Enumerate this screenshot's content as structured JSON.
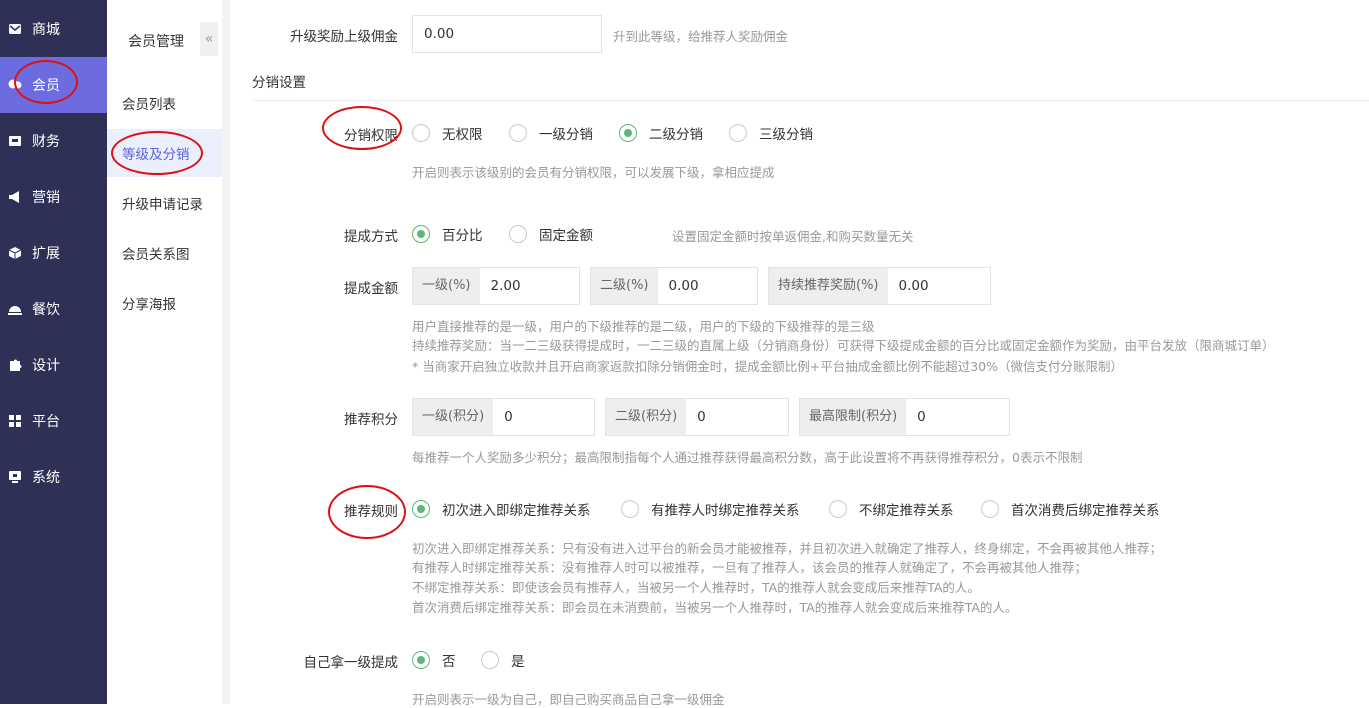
{
  "nav": {
    "items": [
      {
        "label": "商城",
        "icon": "mail-icon"
      },
      {
        "label": "会员",
        "icon": "member-icon"
      },
      {
        "label": "财务",
        "icon": "wallet-icon"
      },
      {
        "label": "营销",
        "icon": "megaphone-icon"
      },
      {
        "label": "扩展",
        "icon": "cube-icon"
      },
      {
        "label": "餐饮",
        "icon": "dish-icon"
      },
      {
        "label": "设计",
        "icon": "puzzle-icon"
      },
      {
        "label": "平台",
        "icon": "grid-icon"
      },
      {
        "label": "系统",
        "icon": "monitor-icon"
      }
    ],
    "active_color": "#6c6ce0",
    "background": "#2f3055"
  },
  "submenu": {
    "title": "会员管理",
    "collapse_glyph": "«",
    "items": [
      {
        "label": "会员列表"
      },
      {
        "label": "等级及分销"
      },
      {
        "label": "升级申请记录"
      },
      {
        "label": "会员关系图"
      },
      {
        "label": "分享海报"
      }
    ]
  },
  "form": {
    "upgrade_reward": {
      "label": "升级奖励上级佣金",
      "value": "0.00",
      "hint": "升到此等级，给推荐人奖励佣金"
    },
    "section_title": "分销设置",
    "permission": {
      "label": "分销权限",
      "options": [
        "无权限",
        "一级分销",
        "二级分销",
        "三级分销"
      ],
      "selected": 2,
      "hint": "开启则表示该级别的会员有分销权限，可以发展下级，拿相应提成"
    },
    "commission_mode": {
      "label": "提成方式",
      "options": [
        "百分比",
        "固定金额"
      ],
      "selected": 0,
      "hint": "设置固定金额时按单返佣金,和购买数量无关"
    },
    "commission_amount": {
      "label": "提成金额",
      "fields": [
        {
          "addon": "一级(%)",
          "value": "2.00"
        },
        {
          "addon": "二级(%)",
          "value": "0.00"
        },
        {
          "addon": "持续推荐奖励(%)",
          "value": "0.00"
        }
      ],
      "hints": [
        "用户直接推荐的是一级，用户的下级推荐的是二级，用户的下级的下级推荐的是三级",
        "持续推荐奖励：当一二三级获得提成时，一二三级的直属上级（分销商身份）可获得下级提成金额的百分比或固定金额作为奖励，由平台发放（限商城订单）",
        "* 当商家开启独立收款并且开启商家返款扣除分销佣金时，提成金额比例+平台抽成金额比例不能超过30%（微信支付分账限制）"
      ]
    },
    "points": {
      "label": "推荐积分",
      "fields": [
        {
          "addon": "一级(积分)",
          "value": "0"
        },
        {
          "addon": "二级(积分)",
          "value": "0"
        },
        {
          "addon": "最高限制(积分)",
          "value": "0"
        }
      ],
      "hint": "每推荐一个人奖励多少积分；最高限制指每个人通过推荐获得最高积分数，高于此设置将不再获得推荐积分，0表示不限制"
    },
    "rule": {
      "label": "推荐规则",
      "options": [
        "初次进入即绑定推荐关系",
        "有推荐人时绑定推荐关系",
        "不绑定推荐关系",
        "首次消费后绑定推荐关系"
      ],
      "selected": 0,
      "hints": [
        "初次进入即绑定推荐关系：只有没有进入过平台的新会员才能被推荐，并且初次进入就确定了推荐人，终身绑定，不会再被其他人推荐；",
        "有推荐人时绑定推荐关系：没有推荐人时可以被推荐，一旦有了推荐人，该会员的推荐人就确定了，不会再被其他人推荐；",
        "不绑定推荐关系：即使该会员有推荐人，当被另一个人推荐时，TA的推荐人就会变成后来推荐TA的人。",
        "首次消费后绑定推荐关系：即会员在未消费前，当被另一个人推荐时，TA的推荐人就会变成后来推荐TA的人。"
      ]
    },
    "self_commission": {
      "label": "自己拿一级提成",
      "options": [
        "否",
        "是"
      ],
      "selected": 0,
      "hint": "开启则表示一级为自己，即自己购买商品自己拿一级佣金"
    }
  }
}
